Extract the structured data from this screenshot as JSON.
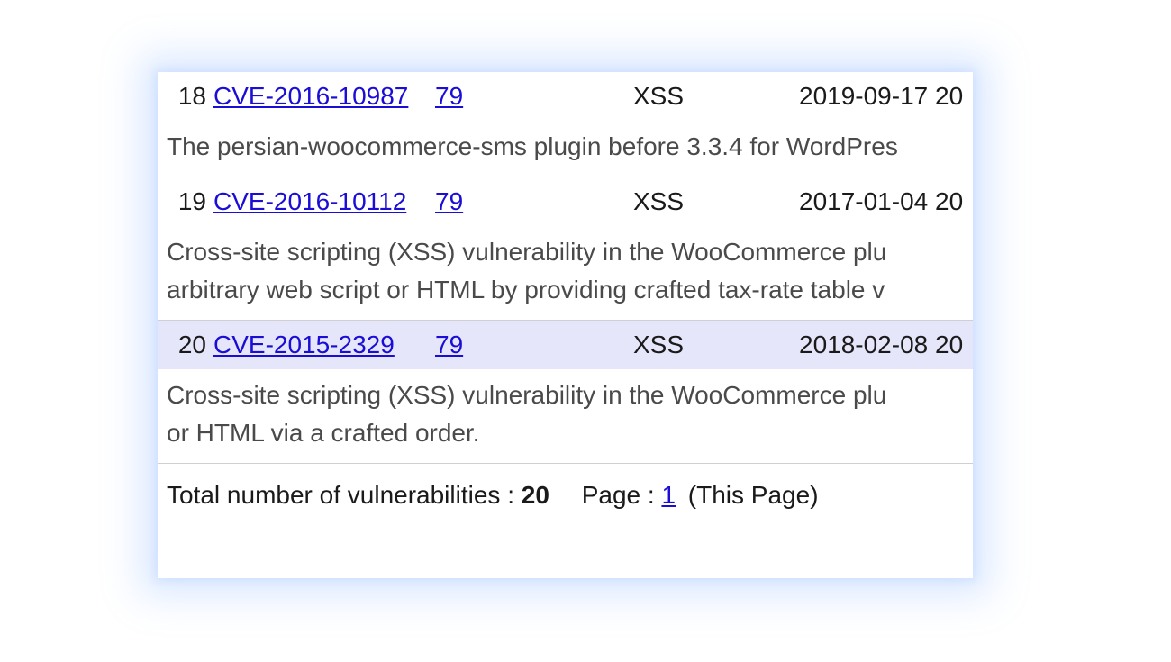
{
  "rows": [
    {
      "index": "18",
      "cve": "CVE-2016-10987",
      "cwe": "79",
      "type": "XSS",
      "date": "2019-09-17 20",
      "highlight": false,
      "desc_lines": [
        "The persian-woocommerce-sms plugin before 3.3.4 for WordPres"
      ]
    },
    {
      "index": "19",
      "cve": "CVE-2016-10112",
      "cwe": "79",
      "type": "XSS",
      "date": "2017-01-04 20",
      "highlight": false,
      "desc_lines": [
        "Cross-site scripting (XSS) vulnerability in the WooCommerce plu",
        "arbitrary web script or HTML by providing crafted tax-rate table v"
      ]
    },
    {
      "index": "20",
      "cve": "CVE-2015-2329",
      "cwe": "79",
      "type": "XSS",
      "date": "2018-02-08 20",
      "highlight": true,
      "desc_lines": [
        "Cross-site scripting (XSS) vulnerability in the WooCommerce plu",
        "or HTML via a crafted order."
      ]
    }
  ],
  "footer": {
    "total_label": "Total number of vulnerabilities :",
    "total_value": "20",
    "page_label": "Page :",
    "page_link": "1",
    "this_page": "(This Page)"
  }
}
